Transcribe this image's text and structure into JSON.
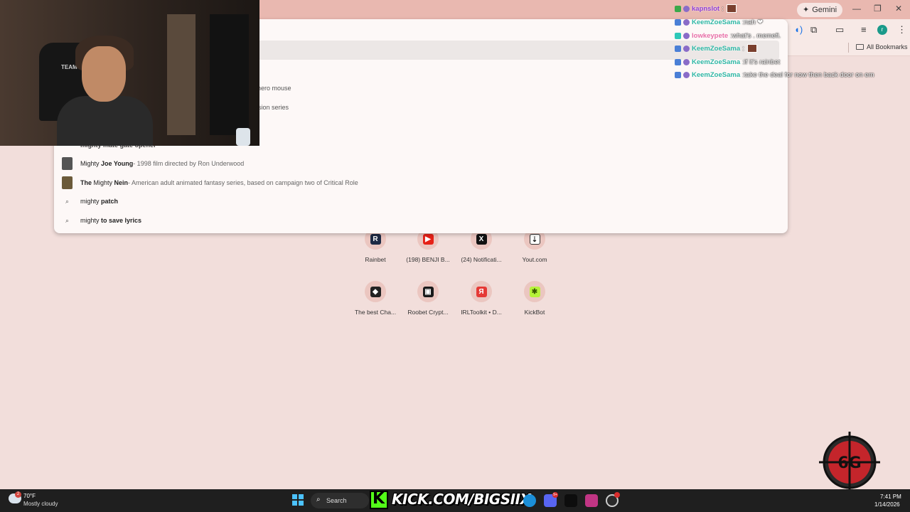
{
  "browser": {
    "gemini_label": "Gemini",
    "minimize_icon": "minimize-icon",
    "restore_icon": "restore-icon",
    "close_icon": "close-icon",
    "all_bookmarks_label": "All Bookmarks",
    "profile_initial": "r"
  },
  "omnibox_dropdown": {
    "partial_rows": [
      {
        "text": "hero mouse"
      },
      {
        "text": "ision series"
      },
      {
        "text": "mighty mate gate opener"
      }
    ],
    "rows": [
      {
        "prefix": "Mighty ",
        "bold": "Joe Young",
        "desc": " - 1998 film directed by Ron Underwood",
        "type": "entity",
        "thumb_color": "#555555"
      },
      {
        "prefix": "The ",
        "bold_prefix": "The",
        "mid": " Mighty ",
        "bold": "Nein",
        "desc": " - American adult animated fantasy series, based on campaign two of Critical Role",
        "type": "entity",
        "thumb_color": "#6b5a3a"
      },
      {
        "prefix": "mighty ",
        "bold": "patch",
        "desc": "",
        "type": "search"
      },
      {
        "prefix": "mighty ",
        "bold": "to save lyrics",
        "desc": "",
        "type": "search"
      }
    ]
  },
  "shortcuts": [
    {
      "label": "Rainbet",
      "icon": "rainbet-icon",
      "color": "#1e2a44",
      "glyph": "R"
    },
    {
      "label": "(198) BENJI B...",
      "icon": "youtube-icon",
      "color": "#e62117",
      "glyph": "▶"
    },
    {
      "label": "(24) Notificati...",
      "icon": "x-icon",
      "color": "#111111",
      "glyph": "X"
    },
    {
      "label": "Yout.com",
      "icon": "yout-icon",
      "color": "#ffffff",
      "glyph": "⇣"
    },
    {
      "label": "The best Cha...",
      "icon": "chat-icon",
      "color": "#222222",
      "glyph": "◆"
    },
    {
      "label": "Roobet Crypt...",
      "icon": "roobet-icon",
      "color": "#1a1a1a",
      "glyph": "▣"
    },
    {
      "label": "IRLToolkit • D...",
      "icon": "irltoolkit-icon",
      "color": "#e53935",
      "glyph": "Я"
    },
    {
      "label": "KickBot",
      "icon": "kickbot-icon",
      "color": "#b6f23a",
      "glyph": "✱"
    }
  ],
  "chat": [
    {
      "user": "kapnslot",
      "sep": " :",
      "msg": "",
      "user_color": "#8f3fd6",
      "badge": "#3aa84a"
    },
    {
      "user": "KeemZoeSama",
      "sep": " :",
      "msg": " nah ❤",
      "user_color": "#2fb8a6",
      "badge": "#4a7fd6"
    },
    {
      "user": "lowkeypete",
      "sep": " :",
      "msg": " what's . memefi.",
      "user_color": "#e86fa8",
      "badge": "#2ec8b8"
    },
    {
      "user": "KeemZoeSama",
      "sep": " :",
      "msg": "",
      "user_color": "#2fb8a6",
      "badge": "#4a7fd6"
    },
    {
      "user": "KeemZoeSama",
      "sep": " :",
      "msg": " if it's rainbet",
      "user_color": "#2fb8a6",
      "badge": "#4a7fd6"
    },
    {
      "user": "KeemZoeSama",
      "sep": " :",
      "msg": " take the deal for now then back door on em",
      "user_color": "#2fb8a6",
      "badge": "#4a7fd6"
    }
  ],
  "webcam": {
    "chair_logo": "TEAMVM"
  },
  "taskbar": {
    "weather_temp": "70°F",
    "weather_desc": "Mostly cloudy",
    "weather_badge": "2",
    "search_label": "Search",
    "kick_banner": "KICK.COM/BIGSIIX",
    "time": "7:41 PM",
    "date": "1/14/2026",
    "apps": [
      {
        "icon": "edge-icon",
        "color": "#1b8fd8"
      },
      {
        "icon": "discord-icon",
        "color": "#5865f2",
        "badge": "9+"
      },
      {
        "icon": "streaming-app-icon",
        "color": "#0d0d0d"
      },
      {
        "icon": "instagram-icon",
        "color": "#c13584"
      },
      {
        "icon": "obs-icon",
        "color": "#2a2a2a",
        "badge": " "
      }
    ]
  },
  "colors": {
    "page_bg": "#f2dedb",
    "titlebar": "#e9b8b0",
    "kick_green": "#53fc18"
  }
}
